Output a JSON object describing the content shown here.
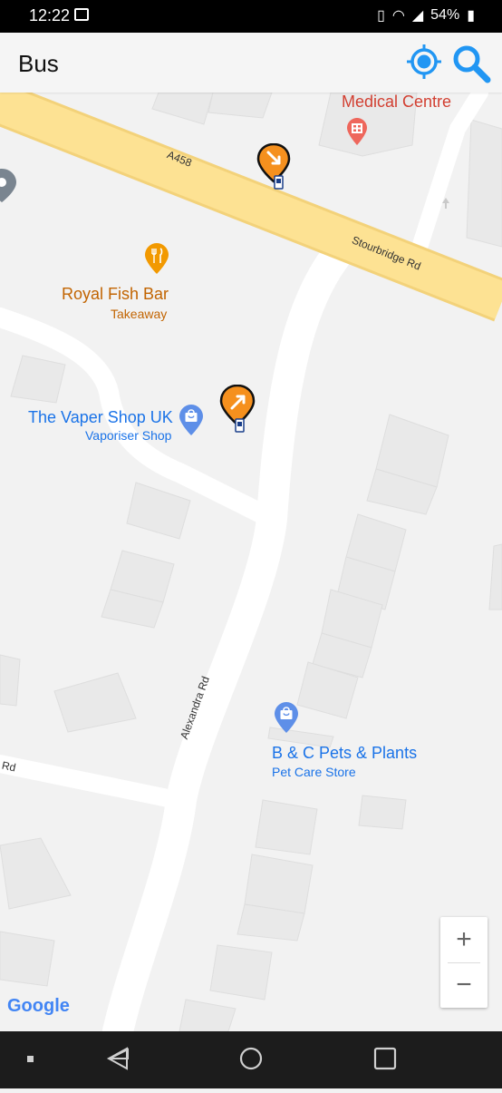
{
  "status": {
    "time": "12:22",
    "battery": "54%"
  },
  "appbar": {
    "title": "Bus",
    "icons": [
      "location-target-icon",
      "search-icon"
    ]
  },
  "pois": [
    {
      "name": "Medical Centre",
      "color": "#d23f31"
    },
    {
      "name": "Royal Fish Bar",
      "sub": "Takeaway",
      "color": "#e37400"
    },
    {
      "name": "The Vaper Shop UK",
      "sub": "Vaporiser Shop",
      "color": "#1a73e8"
    },
    {
      "name": "B & C Pets & Plants",
      "sub": "Pet Care Store",
      "color": "#1a73e8"
    }
  ],
  "roads": [
    "A458",
    "Stourbridge Rd",
    "Alexandra Rd",
    "Rd"
  ],
  "zoom": {
    "in": "+",
    "out": "−"
  },
  "attribution": "Google",
  "colors": {
    "bus_stop": "#f5901e",
    "accent": "#2196f3",
    "main_road": "#fde293"
  }
}
